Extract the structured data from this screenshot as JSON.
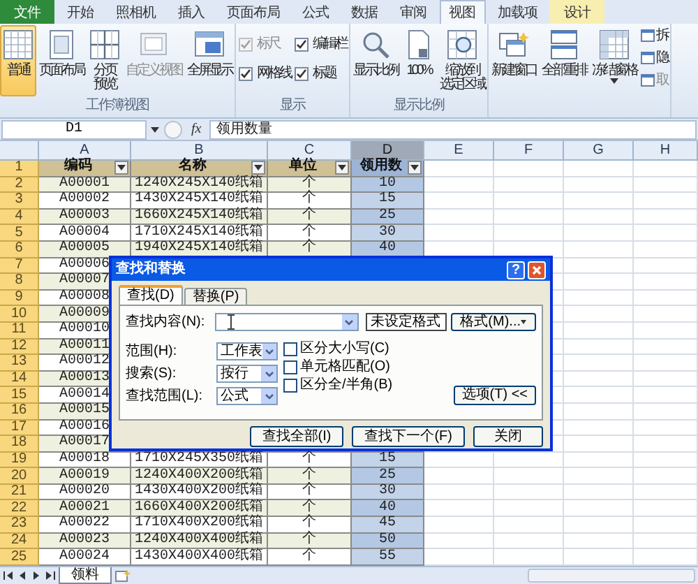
{
  "tabs": [
    {
      "label": "文件",
      "kind": "file",
      "selected": false
    },
    {
      "label": "开始",
      "kind": "normal",
      "selected": false
    },
    {
      "label": "照相机",
      "kind": "normal",
      "selected": false
    },
    {
      "label": "插入",
      "kind": "normal",
      "selected": false
    },
    {
      "label": "页面布局",
      "kind": "normal",
      "selected": false
    },
    {
      "label": "公式",
      "kind": "normal",
      "selected": false
    },
    {
      "label": "数据",
      "kind": "normal",
      "selected": false
    },
    {
      "label": "审阅",
      "kind": "normal",
      "selected": false
    },
    {
      "label": "视图",
      "kind": "normal",
      "selected": true
    },
    {
      "label": "加载项",
      "kind": "normal",
      "selected": false
    },
    {
      "label": "设计",
      "kind": "contextual",
      "selected": false
    }
  ],
  "ribbon": {
    "groups": [
      {
        "label": "工作簿视图",
        "items": [
          {
            "kind": "large",
            "label": "普通",
            "selected": true,
            "disabled": false
          },
          {
            "kind": "large",
            "label": "页面布局",
            "selected": false,
            "disabled": false
          },
          {
            "kind": "large",
            "label": "分页预览",
            "selected": false,
            "disabled": false
          },
          {
            "kind": "large",
            "label": "自定义视图",
            "selected": false,
            "disabled": true
          },
          {
            "kind": "large",
            "label": "全屏显示",
            "selected": false,
            "disabled": false
          }
        ]
      },
      {
        "label": "显示",
        "items": [
          {
            "kind": "check",
            "label": "标尺",
            "checked": true,
            "disabled": true
          },
          {
            "kind": "check",
            "label": "编辑栏",
            "checked": true,
            "disabled": false
          },
          {
            "kind": "check",
            "label": "网格线",
            "checked": true,
            "disabled": false
          },
          {
            "kind": "check",
            "label": "标题",
            "checked": true,
            "disabled": false
          }
        ]
      },
      {
        "label": "显示比例",
        "items": [
          {
            "kind": "large",
            "label": "显示比例",
            "disabled": false
          },
          {
            "kind": "large",
            "label": "100%",
            "disabled": false
          },
          {
            "kind": "large",
            "label": "缩放到选定区域",
            "disabled": false
          }
        ]
      },
      {
        "items": [
          {
            "kind": "large",
            "label": "新建窗口",
            "disabled": false
          },
          {
            "kind": "large",
            "label": "全部重排",
            "disabled": false
          },
          {
            "kind": "large",
            "label": "冻结窗格",
            "disabled": false,
            "dropdown": true
          },
          {
            "kind": "small",
            "label": "拆",
            "disabled": false
          },
          {
            "kind": "small",
            "label": "隐",
            "disabled": false
          },
          {
            "kind": "small",
            "label": "取",
            "disabled": true
          }
        ]
      }
    ]
  },
  "formula_bar": {
    "name_box": "D1",
    "function_label": "fx",
    "value": "领用数量"
  },
  "sheet": {
    "columns": [
      {
        "label": "A",
        "selected": false
      },
      {
        "label": "B",
        "selected": false
      },
      {
        "label": "C",
        "selected": false
      },
      {
        "label": "D",
        "selected": true
      },
      {
        "label": "E",
        "selected": false
      },
      {
        "label": "F",
        "selected": false
      },
      {
        "label": "G",
        "selected": false
      },
      {
        "label": "H",
        "selected": false
      }
    ],
    "rows": [
      {
        "number": "1",
        "kind": "header",
        "cells": [
          "编码",
          "名称",
          "单位",
          "领用数"
        ]
      },
      {
        "number": "2",
        "kind": "data",
        "cells": [
          "A00001",
          "1240X245X140纸箱",
          "个",
          "10"
        ]
      },
      {
        "number": "3",
        "kind": "data",
        "cells": [
          "A00002",
          "1430X245X140纸箱",
          "个",
          "15"
        ]
      },
      {
        "number": "4",
        "kind": "data",
        "cells": [
          "A00003",
          "1660X245X140纸箱",
          "个",
          "25"
        ]
      },
      {
        "number": "5",
        "kind": "data",
        "cells": [
          "A00004",
          "1710X245X140纸箱",
          "个",
          "30"
        ]
      },
      {
        "number": "6",
        "kind": "data",
        "cells": [
          "A00005",
          "1940X245X140纸箱",
          "个",
          "40"
        ]
      },
      {
        "number": "7",
        "kind": "data",
        "cells": [
          "A00006"
        ]
      },
      {
        "number": "8",
        "kind": "data",
        "cells": [
          "A00007"
        ]
      },
      {
        "number": "9",
        "kind": "data",
        "cells": [
          "A00008"
        ]
      },
      {
        "number": "10",
        "kind": "data",
        "cells": [
          "A00009"
        ]
      },
      {
        "number": "11",
        "kind": "data",
        "cells": [
          "A00010"
        ]
      },
      {
        "number": "12",
        "kind": "data",
        "cells": [
          "A00011"
        ]
      },
      {
        "number": "13",
        "kind": "data",
        "cells": [
          "A00012"
        ]
      },
      {
        "number": "14",
        "kind": "data",
        "cells": [
          "A00013"
        ]
      },
      {
        "number": "15",
        "kind": "data",
        "cells": [
          "A00014"
        ]
      },
      {
        "number": "16",
        "kind": "data",
        "cells": [
          "A00015"
        ]
      },
      {
        "number": "17",
        "kind": "data",
        "cells": [
          "A00016"
        ]
      },
      {
        "number": "18",
        "kind": "data",
        "cells": [
          "A00017"
        ]
      },
      {
        "number": "19",
        "kind": "data",
        "cells": [
          "A00018",
          "1710X245X350纸箱",
          "个",
          "15"
        ]
      },
      {
        "number": "20",
        "kind": "data",
        "cells": [
          "A00019",
          "1240X400X200纸箱",
          "个",
          "25"
        ]
      },
      {
        "number": "21",
        "kind": "data",
        "cells": [
          "A00020",
          "1430X400X200纸箱",
          "个",
          "30"
        ]
      },
      {
        "number": "22",
        "kind": "data",
        "cells": [
          "A00021",
          "1660X400X200纸箱",
          "个",
          "40"
        ]
      },
      {
        "number": "23",
        "kind": "data",
        "cells": [
          "A00022",
          "1710X400X200纸箱",
          "个",
          "45"
        ]
      },
      {
        "number": "24",
        "kind": "data",
        "cells": [
          "A00023",
          "1240X400X400纸箱",
          "个",
          "50"
        ]
      },
      {
        "number": "25",
        "kind": "data",
        "cells": [
          "A00024",
          "1430X400X400纸箱",
          "个",
          "55"
        ]
      }
    ]
  },
  "sheet_tabs": [
    {
      "label": "领料",
      "selected": true
    }
  ],
  "dialog": {
    "title": "查找和替换",
    "help_button": "?",
    "tabs": [
      {
        "label": "查找(D)",
        "selected": true
      },
      {
        "label": "替换(P)",
        "selected": false
      }
    ],
    "find_label": "查找内容(N):",
    "format_status": "未设定格式",
    "format_button": "格式(M)...",
    "options": [
      {
        "label": "范围(H):",
        "value": "工作表"
      },
      {
        "label": "搜索(S):",
        "value": "按行"
      },
      {
        "label": "查找范围(L):",
        "value": "公式"
      }
    ],
    "checks": [
      {
        "label": "区分大小写(C)",
        "checked": false
      },
      {
        "label": "单元格匹配(O)",
        "checked": false
      },
      {
        "label": "区分全/半角(B)",
        "checked": false
      }
    ],
    "options_button": "选项(T) <<",
    "buttons": [
      {
        "label": "查找全部(I)"
      },
      {
        "label": "查找下一个(F)"
      },
      {
        "label": "关闭"
      }
    ]
  }
}
